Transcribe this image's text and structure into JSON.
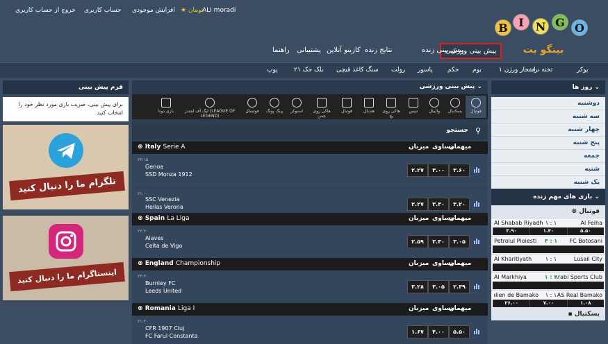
{
  "header": {
    "top_links": [
      "خروج از حساب کاربری",
      "حساب کاربری",
      "افزایش موجودی"
    ],
    "currency": "تومان",
    "username": "ALI moradi",
    "logo_letters": [
      "B",
      "I",
      "N",
      "G",
      "O"
    ],
    "logo_sub": "بینگو بت"
  },
  "main_nav": [
    "پیش بینی ورزشی",
    "پیش بینی زنده",
    "نتایج زنده",
    "کازینو آنلاین",
    "پشتیبانی",
    "راهنما"
  ],
  "sub_nav": [
    "پوکر",
    "تخته نرد",
    "انفجار ورژن ۱",
    "بوم",
    "حکم",
    "پاسور",
    "رولت",
    "سنگ کاغذ قیچی",
    "بلک جک ۲۱",
    "پوپ"
  ],
  "right": {
    "days_title": "روز ها",
    "days": [
      "دوشنبه",
      "سه شنبه",
      "چهار شنبه",
      "پنج شنبه",
      "جمعه",
      "شنبه",
      "یک شنبه"
    ],
    "live_title": "بازی های مهم زنده",
    "live_sport": "فوتبال",
    "live_matches": [
      {
        "home": "Al Feiha",
        "away": "Al Shabab Riyadh",
        "score": "۱ : ۱",
        "odds": [
          "۵.۵۰",
          "۱.۴۰",
          "۳.۹۰"
        ]
      },
      {
        "home": "FC Botosani",
        "away": "Petrolul Ploiesti",
        "score": "۳ : ۱",
        "odds": []
      },
      {
        "home": "Lusail City",
        "away": "Al Kharitiyath",
        "score": "۱ : ۱",
        "odds": []
      },
      {
        "home": "Al-Arabi Sports Club",
        "away": "Al Markhiya",
        "score": "۱ : ۴",
        "odds": []
      },
      {
        "home": "AS Real Bamako",
        "away": "Stade Malien de Bamako",
        "score": "۱ : ۱",
        "odds": [
          "۱.۰۸",
          "۷.۰۰",
          "۲۶.۰۰"
        ]
      }
    ],
    "next_sport": "بسکتبال"
  },
  "center": {
    "title": "پیش بینی ورزشی",
    "sports": [
      "فوتبال",
      "بسکتبال",
      "والیبال",
      "تنیس",
      "هاکی روی یخ",
      "هندبال",
      "فوتبال",
      "هاکی روی چمن",
      "اسنوکر",
      "پینگ پونگ",
      "فوتسال",
      "لیگ آف لجندز (LEAGUE OF LEGEND)",
      "بازی دوتا"
    ],
    "search_label": "جستجو",
    "col_home": "میهمان",
    "col_draw": "مساوی",
    "col_away": "میزبان",
    "leagues": [
      {
        "country": "Italy",
        "league": "Serie A",
        "time": "۲۳:۱۵",
        "team1": "Genoa",
        "team2": "SSD Monza 1912",
        "odds": [
          "۳.۶۰",
          "۳.۰۰",
          "۲.۲۷"
        ]
      },
      {
        "country": "",
        "league": "",
        "time": "۲۱:۰۰",
        "team1": "SSC Venezia",
        "team2": "Hellas Verona",
        "odds": [
          "۳.۲۰",
          "۳.۳۰",
          "۲.۲۷"
        ]
      },
      {
        "country": "Spain",
        "league": "La Liga",
        "time": "۲۳:۳۰",
        "team1": "Alaves",
        "team2": "Celta de Vigo",
        "odds": [
          "۳.۰۵",
          "۳.۳۰",
          "۲.۵۹"
        ]
      },
      {
        "country": "England",
        "league": "Championship",
        "time": "۲۳:۳۰",
        "team1": "Burnley FC",
        "team2": "Leeds United",
        "odds": [
          "۲.۳۹",
          "۳.۰۵",
          "۳.۲۸"
        ]
      },
      {
        "country": "Romania",
        "league": "Liga I",
        "time": "۲۱:۳۰",
        "team1": "CFR 1907 Cluj",
        "team2": "FC Farul Constanta",
        "odds": [
          "۵.۵۰",
          "۴.۰۰",
          "۱.۶۷"
        ]
      }
    ]
  },
  "left": {
    "form_title": "فرم پیش بینی",
    "form_text": "برای پیش بینی، ضریب بازی مورد نظر خود را انتخاب کنید",
    "ad1": "تلگرام ما را دنبال کنید",
    "ad2": "اینستاگرام ما را دنبال کنید"
  },
  "colors": {
    "bg": "#3b4d63",
    "accent": "#e02020",
    "dark": "#1c1c1c"
  }
}
